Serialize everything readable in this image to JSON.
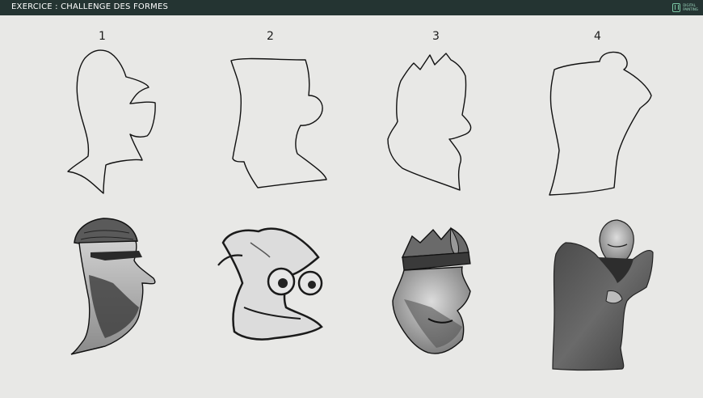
{
  "header": {
    "title": "EXERCICE : CHALLENGE DES FORMES",
    "logo_line1": "DIGITAL",
    "logo_line2": "PAINTING"
  },
  "shapes": [
    {
      "number": "1"
    },
    {
      "number": "2"
    },
    {
      "number": "3"
    },
    {
      "number": "4"
    }
  ],
  "colors": {
    "background": "#e8e8e6",
    "header": "#243432",
    "accent": "#7cc7a4"
  }
}
